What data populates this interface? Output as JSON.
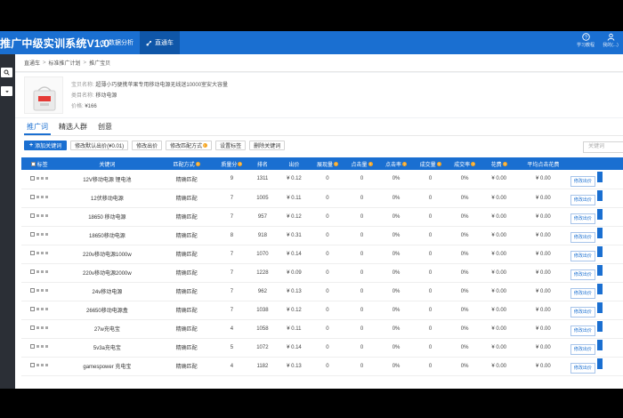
{
  "app": {
    "title": "推广中级实训系统V1.0"
  },
  "top_nav": [
    {
      "label": "数据分析",
      "icon": "analytics-icon"
    },
    {
      "label": "直通车",
      "icon": "car-icon"
    }
  ],
  "top_right": [
    {
      "label": "学习教程",
      "icon": "help-icon"
    },
    {
      "label": "我的(...)",
      "icon": "user-icon"
    }
  ],
  "breadcrumb": [
    "直通车",
    "标准推广计划",
    "推广宝贝"
  ],
  "product": {
    "name_label": "宝贝名称:",
    "name_value": "超薄小巧便携苹果专用移动电源无线迷10000室安大容量",
    "category_label": "类目名称:",
    "category_value": "移动电源",
    "price_label": "价格:",
    "price_value": "¥166"
  },
  "tabs": [
    "推广词",
    "精选人群",
    "创意"
  ],
  "toolbar": {
    "add_keyword": "添加关键词",
    "modify_default_bid": "修改默认出价(¥0.01)",
    "modify_bid": "修改出价",
    "modify_match": "修改匹配方式",
    "set_tag": "设置标签",
    "delete_keyword": "删除关键词"
  },
  "search": {
    "placeholder": "关键词"
  },
  "table": {
    "headers": [
      "标签",
      "关键词",
      "匹配方式",
      "质量分",
      "排名",
      "出价",
      "展现量",
      "点击量",
      "点击率",
      "成交量",
      "成交率",
      "花费",
      "平均点击花费"
    ],
    "row_action": "修改出价",
    "rows": [
      {
        "keyword": "12V移动电源 锂电池",
        "match": "精确匹配",
        "quality": "9",
        "rank": "1311",
        "bid": "¥ 0.12",
        "impressions": "0",
        "clicks": "0",
        "ctr": "0%",
        "orders": "0",
        "cvr": "0%",
        "cost": "¥ 0.00",
        "avg_cost": "¥ 0.00"
      },
      {
        "keyword": "12伏移动电源",
        "match": "精确匹配",
        "quality": "7",
        "rank": "1005",
        "bid": "¥ 0.11",
        "impressions": "0",
        "clicks": "0",
        "ctr": "0%",
        "orders": "0",
        "cvr": "0%",
        "cost": "¥ 0.00",
        "avg_cost": "¥ 0.00"
      },
      {
        "keyword": "18650 移动电源",
        "match": "精确匹配",
        "quality": "7",
        "rank": "957",
        "bid": "¥ 0.12",
        "impressions": "0",
        "clicks": "0",
        "ctr": "0%",
        "orders": "0",
        "cvr": "0%",
        "cost": "¥ 0.00",
        "avg_cost": "¥ 0.00"
      },
      {
        "keyword": "18650移动电源",
        "match": "精确匹配",
        "quality": "8",
        "rank": "918",
        "bid": "¥ 0.31",
        "impressions": "0",
        "clicks": "0",
        "ctr": "0%",
        "orders": "0",
        "cvr": "0%",
        "cost": "¥ 0.00",
        "avg_cost": "¥ 0.00"
      },
      {
        "keyword": "220v移动电源1000w",
        "match": "精确匹配",
        "quality": "7",
        "rank": "1070",
        "bid": "¥ 0.14",
        "impressions": "0",
        "clicks": "0",
        "ctr": "0%",
        "orders": "0",
        "cvr": "0%",
        "cost": "¥ 0.00",
        "avg_cost": "¥ 0.00"
      },
      {
        "keyword": "220v移动电源2000w",
        "match": "精确匹配",
        "quality": "7",
        "rank": "1228",
        "bid": "¥ 0.09",
        "impressions": "0",
        "clicks": "0",
        "ctr": "0%",
        "orders": "0",
        "cvr": "0%",
        "cost": "¥ 0.00",
        "avg_cost": "¥ 0.00"
      },
      {
        "keyword": "24v移动电源",
        "match": "精确匹配",
        "quality": "7",
        "rank": "962",
        "bid": "¥ 0.13",
        "impressions": "0",
        "clicks": "0",
        "ctr": "0%",
        "orders": "0",
        "cvr": "0%",
        "cost": "¥ 0.00",
        "avg_cost": "¥ 0.00"
      },
      {
        "keyword": "26650移动电源盒",
        "match": "精确匹配",
        "quality": "7",
        "rank": "1038",
        "bid": "¥ 0.12",
        "impressions": "0",
        "clicks": "0",
        "ctr": "0%",
        "orders": "0",
        "cvr": "0%",
        "cost": "¥ 0.00",
        "avg_cost": "¥ 0.00"
      },
      {
        "keyword": "27w充电宝",
        "match": "精确匹配",
        "quality": "4",
        "rank": "1058",
        "bid": "¥ 0.11",
        "impressions": "0",
        "clicks": "0",
        "ctr": "0%",
        "orders": "0",
        "cvr": "0%",
        "cost": "¥ 0.00",
        "avg_cost": "¥ 0.00"
      },
      {
        "keyword": "5v3a充电宝",
        "match": "精确匹配",
        "quality": "5",
        "rank": "1072",
        "bid": "¥ 0.14",
        "impressions": "0",
        "clicks": "0",
        "ctr": "0%",
        "orders": "0",
        "cvr": "0%",
        "cost": "¥ 0.00",
        "avg_cost": "¥ 0.00"
      },
      {
        "keyword": "gamespower 充电宝",
        "match": "精确匹配",
        "quality": "4",
        "rank": "1182",
        "bid": "¥ 0.13",
        "impressions": "0",
        "clicks": "0",
        "ctr": "0%",
        "orders": "0",
        "cvr": "0%",
        "cost": "¥ 0.00",
        "avg_cost": "¥ 0.00"
      }
    ]
  },
  "colors": {
    "brand": "#1a6fd1",
    "help_dot": "#f5a623",
    "sidebar": "#2b2f36"
  }
}
